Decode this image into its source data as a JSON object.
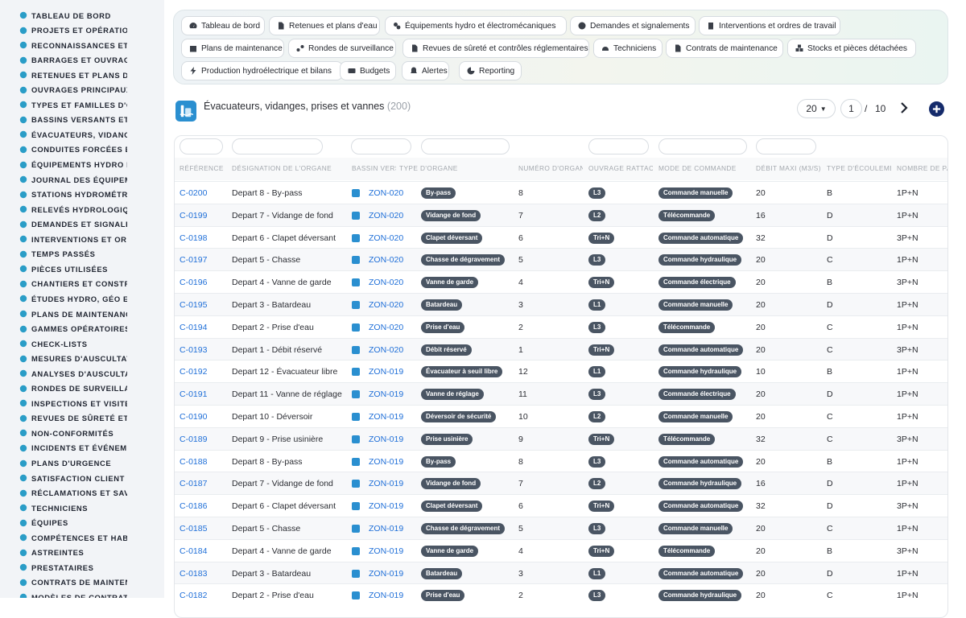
{
  "sidebar": {
    "items": [
      {
        "label": "TABLEAU DE BORD",
        "icon": "gauge-icon"
      },
      {
        "label": "PROJETS ET OPÉRATIONS",
        "icon": "target-icon"
      },
      {
        "label": "RECONNAISSANCES ET VISITES",
        "icon": "list-icon"
      },
      {
        "label": "BARRAGES ET OUVRAGES",
        "icon": "marker-icon"
      },
      {
        "label": "RETENUES ET PLANS D'EAU",
        "icon": "file-icon"
      },
      {
        "label": "OUVRAGES PRINCIPAUX",
        "icon": "check-circle-icon"
      },
      {
        "label": "TYPES ET FAMILLES D'OUVRAGES",
        "icon": "tags-icon"
      },
      {
        "label": "BASSINS VERSANTS ET AFFLUENTS",
        "icon": "grid-icon"
      },
      {
        "label": "ÉVACUATEURS, VIDANGES",
        "icon": "faucet-icon"
      },
      {
        "label": "CONDUITES FORCÉES ET GALERIES",
        "icon": "bars-icon"
      },
      {
        "label": "ÉQUIPEMENTS HYDRO ET ÉLECTROMÉCANIQUES",
        "icon": "cogs-icon"
      },
      {
        "label": "JOURNAL DES ÉQUIPEMENTS",
        "icon": "history-icon"
      },
      {
        "label": "STATIONS HYDROMÉTRIQUES",
        "icon": "antenna-icon"
      },
      {
        "label": "RELEVÉS HYDROLOGIQUES",
        "icon": "clipboard-icon"
      },
      {
        "label": "DEMANDES ET SIGNALEMENTS",
        "icon": "question-icon"
      },
      {
        "label": "INTERVENTIONS ET ORDRES DE TRAVAIL",
        "icon": "clipboard-check-icon"
      },
      {
        "label": "TEMPS PASSÉS",
        "icon": "clock-icon"
      },
      {
        "label": "PIÈCES UTILISÉES",
        "icon": "puzzle-icon"
      },
      {
        "label": "CHANTIERS ET CONSTRUCTIONS",
        "icon": "hammer-icon"
      },
      {
        "label": "ÉTUDES HYDRO, GÉO ET GÉNIE CIVIL",
        "icon": "flask-icon"
      },
      {
        "label": "PLANS DE MAINTENANCE",
        "icon": "calendar-icon"
      },
      {
        "label": "GAMMES OPÉRATOIRES",
        "icon": "stack-icon"
      },
      {
        "label": "CHECK-LISTS",
        "icon": "checklist-icon"
      },
      {
        "label": "MESURES D'AUSCULTATION",
        "icon": "ruler-icon"
      },
      {
        "label": "ANALYSES D'AUSCULTATION",
        "icon": "chart-line-icon"
      },
      {
        "label": "RONDES DE SURVEILLANCE",
        "icon": "route-icon"
      },
      {
        "label": "INSPECTIONS ET VISITES",
        "icon": "search-icon"
      },
      {
        "label": "REVUES DE SÛRETÉ ET CONTRÔLES",
        "icon": "shield-file-icon"
      },
      {
        "label": "NON-CONFORMITÉS",
        "icon": "alert-circle-icon"
      },
      {
        "label": "INCIDENTS ET ÉVÉNEMENTS",
        "icon": "warning-icon"
      },
      {
        "label": "PLANS D'URGENCE",
        "icon": "flag-icon"
      },
      {
        "label": "SATISFACTION CLIENT",
        "icon": "smile-icon"
      },
      {
        "label": "RÉCLAMATIONS ET SAV",
        "icon": "comment-icon"
      },
      {
        "label": "TECHNICIENS",
        "icon": "helmet-icon"
      },
      {
        "label": "ÉQUIPES",
        "icon": "users-icon"
      },
      {
        "label": "COMPÉTENCES ET HABILITATIONS",
        "icon": "badge-icon"
      },
      {
        "label": "ASTREINTES",
        "icon": "phone-icon"
      },
      {
        "label": "PRESTATAIRES",
        "icon": "truck-icon"
      },
      {
        "label": "CONTRATS DE MAINTENANCE",
        "icon": "file-contract-icon"
      },
      {
        "label": "MODÈLES DE CONTRATS",
        "icon": "copy-icon"
      }
    ]
  },
  "nav": {
    "buttons": [
      {
        "label": "Tableau de bord",
        "icon": "gauge-icon"
      },
      {
        "label": "Retenues et plans d'eau",
        "icon": "file-icon"
      },
      {
        "label": "Équipements hydro et électromécaniques",
        "icon": "cogs-icon"
      },
      {
        "label": "Demandes et signalements",
        "icon": "question-icon"
      },
      {
        "label": "Interventions et ordres de travail",
        "icon": "clipboard-check-icon"
      },
      {
        "label": "Plans de maintenance",
        "icon": "calendar-icon"
      },
      {
        "label": "Rondes de surveillance",
        "icon": "route-icon"
      },
      {
        "label": "Revues de sûreté et contrôles réglementaires",
        "icon": "shield-file-icon"
      },
      {
        "label": "Techniciens",
        "icon": "helmet-icon"
      },
      {
        "label": "Contrats de maintenance",
        "icon": "file-contract-icon"
      },
      {
        "label": "Stocks et pièces détachées",
        "icon": "boxes-icon"
      },
      {
        "label": "Production hydroélectrique et bilans",
        "icon": "bolt-icon"
      },
      {
        "label": "Budgets",
        "icon": "money-icon"
      },
      {
        "label": "Alertes",
        "icon": "bell-icon"
      },
      {
        "label": "Reporting",
        "icon": "pie-icon"
      }
    ]
  },
  "page": {
    "title": "Évacuateurs, vidanges, prises et vannes",
    "count": "(200)",
    "per_page": "20",
    "current_page": "1",
    "separator": "/",
    "total_pages": "10"
  },
  "table": {
    "headers": [
      "RÉFÉRENCE",
      "DÉSIGNATION DE L'ORGANE",
      "BASSIN VERSANT",
      "TYPE D'ORGANE",
      "NUMÉRO D'ORGANE",
      "OUVRAGE RATTACHÉ",
      "MODE DE COMMANDE",
      "DÉBIT MAXI (M3/S)",
      "TYPE D'ÉCOULEMENT",
      "NOMBRE DE PASSES"
    ],
    "rows": [
      {
        "ref": "C-0200",
        "name": "Depart 8 - By-pass",
        "zone": "ZON-020",
        "type": "By-pass",
        "num": "8",
        "ouvrage": "L3",
        "mode": "Commande manuelle",
        "debit": "20",
        "ecoul": "B",
        "passes": "1P+N"
      },
      {
        "ref": "C-0199",
        "name": "Depart 7 - Vidange de fond",
        "zone": "ZON-020",
        "type": "Vidange de fond",
        "num": "7",
        "ouvrage": "L2",
        "mode": "Télécommande",
        "debit": "16",
        "ecoul": "D",
        "passes": "1P+N"
      },
      {
        "ref": "C-0198",
        "name": "Depart 6 - Clapet déversant",
        "zone": "ZON-020",
        "type": "Clapet déversant",
        "num": "6",
        "ouvrage": "Tri+N",
        "mode": "Commande automatique",
        "debit": "32",
        "ecoul": "D",
        "passes": "3P+N"
      },
      {
        "ref": "C-0197",
        "name": "Depart 5 - Chasse",
        "zone": "ZON-020",
        "type": "Chasse de dégravement",
        "num": "5",
        "ouvrage": "L3",
        "mode": "Commande hydraulique",
        "debit": "20",
        "ecoul": "C",
        "passes": "1P+N"
      },
      {
        "ref": "C-0196",
        "name": "Depart 4 - Vanne de garde",
        "zone": "ZON-020",
        "type": "Vanne de garde",
        "num": "4",
        "ouvrage": "Tri+N",
        "mode": "Commande électrique",
        "debit": "20",
        "ecoul": "B",
        "passes": "3P+N"
      },
      {
        "ref": "C-0195",
        "name": "Depart 3 - Batardeau",
        "zone": "ZON-020",
        "type": "Batardeau",
        "num": "3",
        "ouvrage": "L1",
        "mode": "Commande manuelle",
        "debit": "20",
        "ecoul": "D",
        "passes": "1P+N"
      },
      {
        "ref": "C-0194",
        "name": "Depart 2 - Prise d'eau",
        "zone": "ZON-020",
        "type": "Prise d'eau",
        "num": "2",
        "ouvrage": "L3",
        "mode": "Télécommande",
        "debit": "20",
        "ecoul": "C",
        "passes": "1P+N"
      },
      {
        "ref": "C-0193",
        "name": "Depart 1 - Débit réservé",
        "zone": "ZON-020",
        "type": "Débit réservé",
        "num": "1",
        "ouvrage": "Tri+N",
        "mode": "Commande automatique",
        "debit": "20",
        "ecoul": "C",
        "passes": "3P+N"
      },
      {
        "ref": "C-0192",
        "name": "Depart 12 - Évacuateur libre",
        "zone": "ZON-019",
        "type": "Évacuateur à seuil libre",
        "num": "12",
        "ouvrage": "L1",
        "mode": "Commande hydraulique",
        "debit": "10",
        "ecoul": "B",
        "passes": "1P+N"
      },
      {
        "ref": "C-0191",
        "name": "Depart 11 - Vanne de réglage",
        "zone": "ZON-019",
        "type": "Vanne de réglage",
        "num": "11",
        "ouvrage": "L3",
        "mode": "Commande électrique",
        "debit": "20",
        "ecoul": "D",
        "passes": "1P+N"
      },
      {
        "ref": "C-0190",
        "name": "Depart 10 - Déversoir",
        "zone": "ZON-019",
        "type": "Déversoir de sécurité",
        "num": "10",
        "ouvrage": "L2",
        "mode": "Commande manuelle",
        "debit": "20",
        "ecoul": "C",
        "passes": "1P+N"
      },
      {
        "ref": "C-0189",
        "name": "Depart 9 - Prise usinière",
        "zone": "ZON-019",
        "type": "Prise usinière",
        "num": "9",
        "ouvrage": "Tri+N",
        "mode": "Télécommande",
        "debit": "32",
        "ecoul": "C",
        "passes": "3P+N"
      },
      {
        "ref": "C-0188",
        "name": "Depart 8 - By-pass",
        "zone": "ZON-019",
        "type": "By-pass",
        "num": "8",
        "ouvrage": "L3",
        "mode": "Commande automatique",
        "debit": "20",
        "ecoul": "B",
        "passes": "1P+N"
      },
      {
        "ref": "C-0187",
        "name": "Depart 7 - Vidange de fond",
        "zone": "ZON-019",
        "type": "Vidange de fond",
        "num": "7",
        "ouvrage": "L2",
        "mode": "Commande hydraulique",
        "debit": "16",
        "ecoul": "D",
        "passes": "1P+N"
      },
      {
        "ref": "C-0186",
        "name": "Depart 6 - Clapet déversant",
        "zone": "ZON-019",
        "type": "Clapet déversant",
        "num": "6",
        "ouvrage": "Tri+N",
        "mode": "Commande automatique",
        "debit": "32",
        "ecoul": "D",
        "passes": "3P+N"
      },
      {
        "ref": "C-0185",
        "name": "Depart 5 - Chasse",
        "zone": "ZON-019",
        "type": "Chasse de dégravement",
        "num": "5",
        "ouvrage": "L3",
        "mode": "Commande manuelle",
        "debit": "20",
        "ecoul": "C",
        "passes": "1P+N"
      },
      {
        "ref": "C-0184",
        "name": "Depart 4 - Vanne de garde",
        "zone": "ZON-019",
        "type": "Vanne de garde",
        "num": "4",
        "ouvrage": "Tri+N",
        "mode": "Télécommande",
        "debit": "20",
        "ecoul": "B",
        "passes": "3P+N"
      },
      {
        "ref": "C-0183",
        "name": "Depart 3 - Batardeau",
        "zone": "ZON-019",
        "type": "Batardeau",
        "num": "3",
        "ouvrage": "L1",
        "mode": "Commande automatique",
        "debit": "20",
        "ecoul": "D",
        "passes": "1P+N"
      },
      {
        "ref": "C-0182",
        "name": "Depart 2 - Prise d'eau",
        "zone": "ZON-019",
        "type": "Prise d'eau",
        "num": "2",
        "ouvrage": "L3",
        "mode": "Commande hydraulique",
        "debit": "20",
        "ecoul": "C",
        "passes": "1P+N"
      }
    ]
  },
  "colors": {
    "accent": "#1f6fd8",
    "sidebar_icon": "#2a9dc7",
    "badge": "#4a5563",
    "add_button": "#152b6b"
  }
}
